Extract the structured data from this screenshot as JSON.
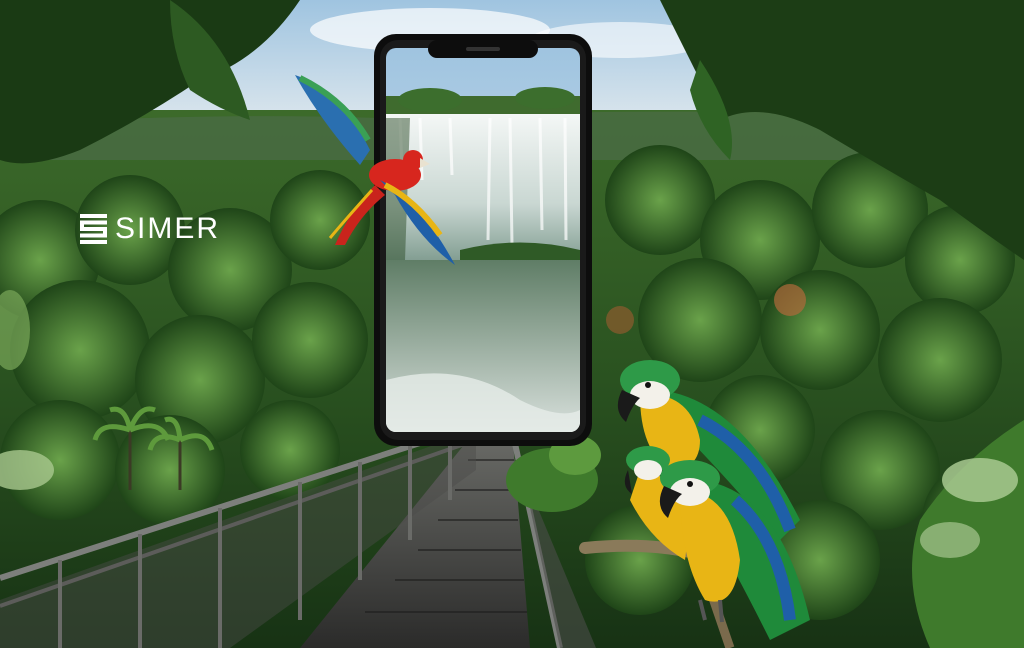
{
  "brand": {
    "name": "SIMER",
    "logo_icon": "stripes-s-logo-icon"
  },
  "palette": {
    "sky": "#cfe0ec",
    "forest_dark": "#1c3a17",
    "forest_mid": "#2f5a22",
    "forest_light": "#4f8a32",
    "phone_frame": "#0d0d0d",
    "waterfall": "#eef3f1",
    "walkway": "#3a3a38",
    "macaw_red": "#d7261e",
    "macaw_green": "#1f8a3a",
    "macaw_yellow": "#e8b515",
    "macaw_blue": "#1f5fa8"
  }
}
